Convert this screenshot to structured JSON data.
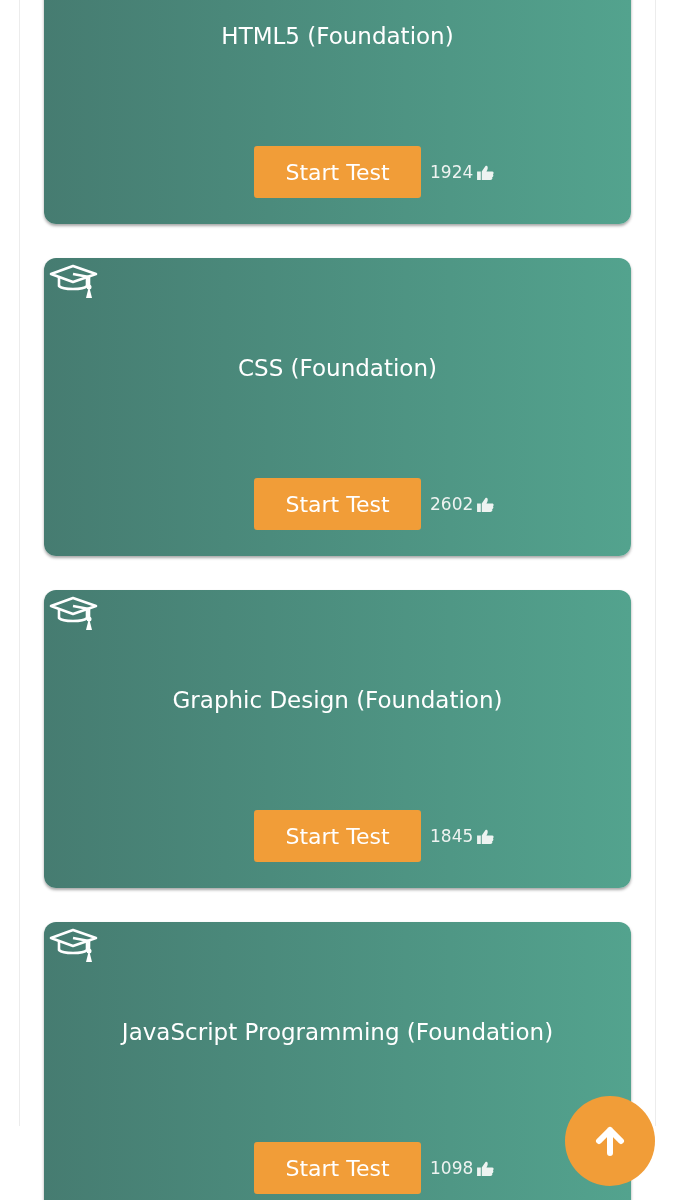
{
  "cards": [
    {
      "cap_icon": false,
      "title": "HTML5 (Foundation)",
      "button": "Start Test",
      "likes": "1924"
    },
    {
      "cap_icon": true,
      "title": "CSS (Foundation)",
      "button": "Start Test",
      "likes": "2602"
    },
    {
      "cap_icon": true,
      "title": "Graphic Design (Foundation)",
      "button": "Start Test",
      "likes": "1845"
    },
    {
      "cap_icon": true,
      "title": "JavaScript Programming (Foundation)",
      "button": "Start Test",
      "likes": "1098"
    }
  ]
}
